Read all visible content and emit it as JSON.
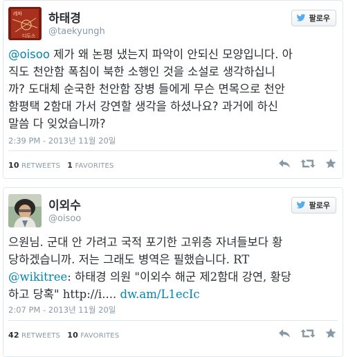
{
  "tweets": [
    {
      "name": "하태경",
      "handle": "@taekyungh",
      "follow_label": "팔로우",
      "avatar_icon": "book-cover-avatar",
      "mention": "@oisoo",
      "text_lines": [
        " 제가 왜 논평 냈는지 파악이 안되신 모양입니다. 아",
        "직도 천안함 폭침이 북한 소행인 것을 소설로 생각하십니",
        "까? 도대체 순국한 천안함 장병 들에게 무슨 면목으로 천안",
        "함평택 2함대 가서 강연할 생각을 하셨나요? 과거에 하신",
        "말씀 다 잊었습니까?"
      ],
      "timestamp": "2:39 PM - 2013년 11월 20일",
      "retweets_count": "10",
      "retweets_label": "RETWEETS",
      "favorites_count": "1",
      "favorites_label": "FAVORITES"
    },
    {
      "name": "이외수",
      "handle": "@oisoo",
      "follow_label": "팔로우",
      "avatar_icon": "portrait-avatar",
      "text_lines": [
        "으원님. 군대 안 가려고 국적 포기한 고위층 자녀들보다 황",
        "당하겠습니까. 저는 그래도 병역은 필했습니다. RT"
      ],
      "mention": "@wikitree",
      "text_line3_rest": ": 하태경 의원 \"이외수 해군 제2함대 강연, 황당",
      "text_line4": "하고 당혹\" http://i.... ",
      "link": "dw.am/L1ecIc",
      "timestamp": "2:07 PM - 2013년 11월 20일",
      "retweets_count": "42",
      "retweets_label": "RETWEETS",
      "favorites_count": "10",
      "favorites_label": "FAVORITES"
    }
  ],
  "colors": {
    "link": "#0084b4",
    "twitter_blue": "#55acee",
    "muted": "#8899a6"
  }
}
